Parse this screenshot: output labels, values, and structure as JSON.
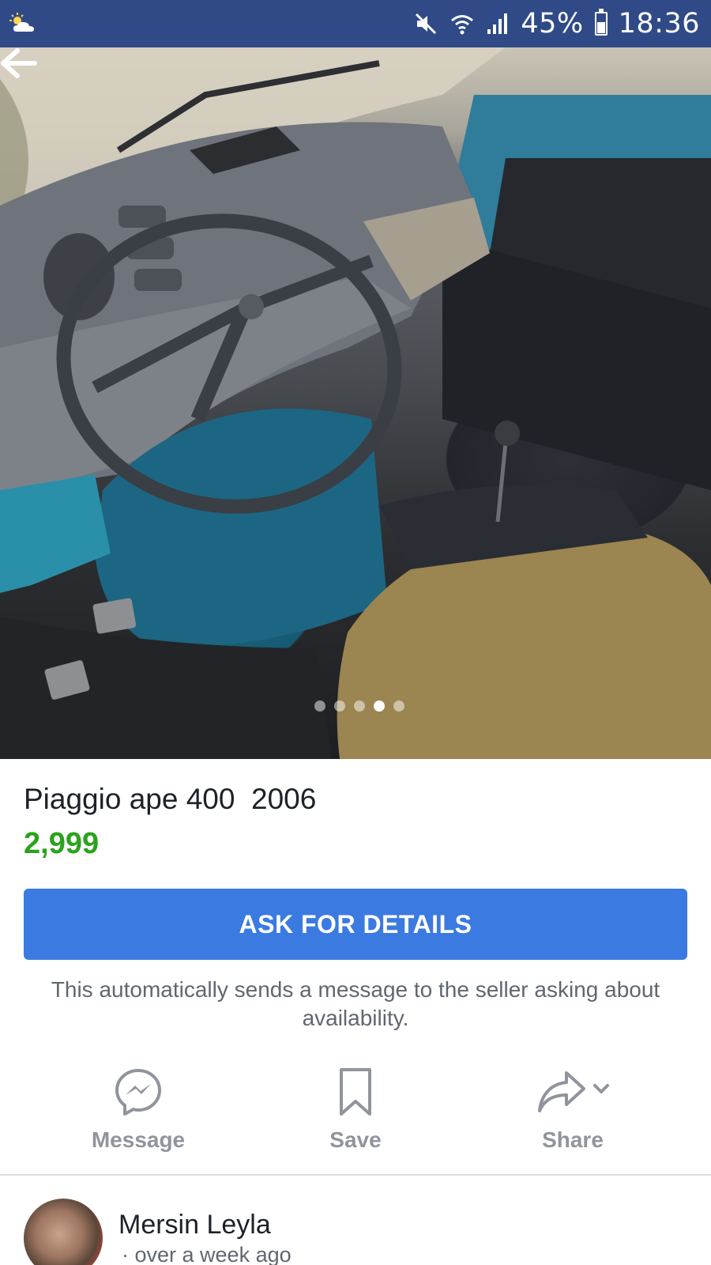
{
  "status_bar": {
    "battery": "45%",
    "time": "18:36",
    "icons": [
      "weather-partly-cloudy-icon",
      "mute-icon",
      "wifi-icon",
      "signal-icon",
      "battery-icon"
    ]
  },
  "photo": {
    "subject": "Piaggio Ape cab interior: dashboard, steering wheel, pedals, seat",
    "carousel": {
      "count": 5,
      "active_index": 3
    }
  },
  "listing": {
    "title": "Piaggio ape 400  2006",
    "price": "2,999"
  },
  "ask_button": {
    "label": "ASK FOR DETAILS"
  },
  "note": "This automatically sends a message to the seller asking about availability.",
  "actions": [
    {
      "label": "Message",
      "icon": "messenger-icon"
    },
    {
      "label": "Save",
      "icon": "bookmark-icon"
    },
    {
      "label": "Share",
      "icon": "share-icon"
    }
  ],
  "seller": {
    "name": "Mersin Leyla",
    "posted": "· over a week ago"
  },
  "colors": {
    "status_bar": "#2f4a86",
    "primary_button": "#3b7ae0",
    "price": "#2aa31c",
    "secondary_text": "#606770",
    "action_label": "#90949c"
  }
}
